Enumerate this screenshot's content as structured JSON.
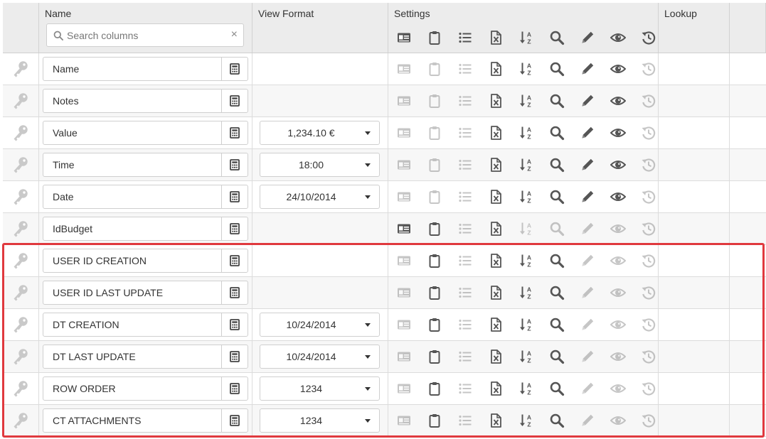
{
  "header": {
    "name": "Name",
    "view_format": "View Format",
    "settings": "Settings",
    "lookup": "Lookup",
    "search_placeholder": "Search columns",
    "clear_symbol": "×"
  },
  "settings_icons": [
    "id-card-icon",
    "clipboard-icon",
    "list-icon",
    "excel-file-icon",
    "sort-alpha-icon",
    "search-icon",
    "pencil-icon",
    "eye-icon",
    "history-icon"
  ],
  "rows": [
    {
      "name": "Name",
      "format": "",
      "active": [
        false,
        false,
        false,
        true,
        true,
        true,
        true,
        true,
        false
      ]
    },
    {
      "name": "Notes",
      "format": "",
      "active": [
        false,
        false,
        false,
        true,
        true,
        true,
        true,
        true,
        false
      ]
    },
    {
      "name": "Value",
      "format": "1,234.10 €",
      "active": [
        false,
        false,
        false,
        true,
        true,
        true,
        true,
        true,
        false
      ]
    },
    {
      "name": "Time",
      "format": "18:00",
      "active": [
        false,
        false,
        false,
        true,
        true,
        true,
        true,
        true,
        false
      ]
    },
    {
      "name": "Date",
      "format": "24/10/2014",
      "active": [
        false,
        false,
        false,
        true,
        true,
        true,
        true,
        true,
        false
      ]
    },
    {
      "name": "IdBudget",
      "format": "",
      "active": [
        true,
        true,
        false,
        true,
        false,
        false,
        false,
        false,
        false
      ]
    },
    {
      "name": "USER ID CREATION",
      "format": "",
      "active": [
        false,
        true,
        false,
        true,
        true,
        true,
        false,
        false,
        false
      ]
    },
    {
      "name": "USER ID LAST UPDATE",
      "format": "",
      "active": [
        false,
        true,
        false,
        true,
        true,
        true,
        false,
        false,
        false
      ]
    },
    {
      "name": "DT CREATION",
      "format": "10/24/2014",
      "active": [
        false,
        true,
        false,
        true,
        true,
        true,
        false,
        false,
        false
      ]
    },
    {
      "name": "DT LAST UPDATE",
      "format": "10/24/2014",
      "active": [
        false,
        true,
        false,
        true,
        true,
        true,
        false,
        false,
        false
      ]
    },
    {
      "name": "ROW ORDER",
      "format": "1234",
      "active": [
        false,
        true,
        false,
        true,
        true,
        true,
        false,
        false,
        false
      ]
    },
    {
      "name": "CT ATTACHMENTS",
      "format": "1234",
      "active": [
        false,
        true,
        false,
        true,
        true,
        true,
        false,
        false,
        false
      ]
    }
  ],
  "colors": {
    "highlight": "#e0393e",
    "icon": "#555555"
  }
}
